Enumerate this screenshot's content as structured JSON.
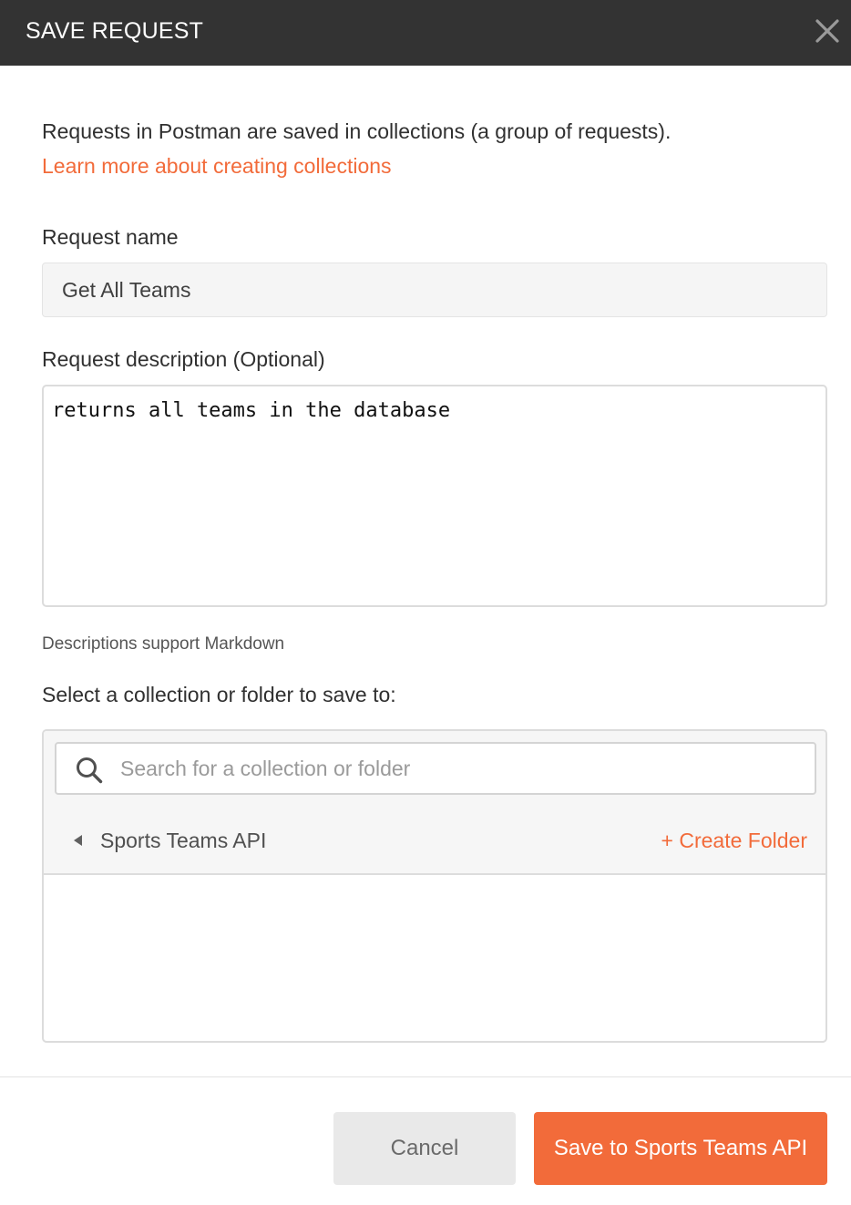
{
  "modal": {
    "title": "SAVE REQUEST",
    "close_icon": "close-icon"
  },
  "intro": {
    "text": "Requests in Postman are saved in collections (a group of requests).",
    "link_text": "Learn more about creating collections"
  },
  "request_name": {
    "label": "Request name",
    "value": "Get All Teams"
  },
  "request_description": {
    "label": "Request description (Optional)",
    "value": "returns all teams in the database",
    "hint": "Descriptions support Markdown"
  },
  "collection_picker": {
    "label": "Select a collection or folder to save to:",
    "search_placeholder": "Search for a collection or folder",
    "search_icon": "search-icon",
    "items": [
      {
        "name": "Sports Teams API",
        "icon": "caret-left-icon"
      }
    ],
    "create_folder_label": "+ Create Folder"
  },
  "footer": {
    "cancel_label": "Cancel",
    "save_label": "Save to Sports Teams API"
  },
  "colors": {
    "header_bg": "#333333",
    "accent": "#f26b3a",
    "cancel_bg": "#e9e9e9"
  }
}
